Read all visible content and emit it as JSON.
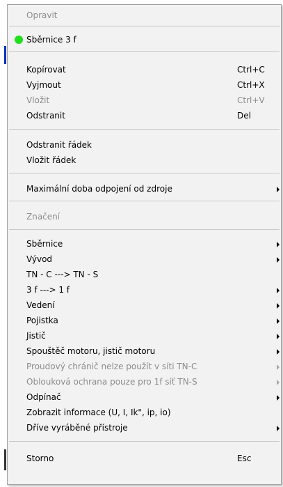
{
  "menu": {
    "items": [
      {
        "label": "Opravit",
        "disabled": true
      },
      {
        "label": "Sběrnice 3 f",
        "indicator": "#1fe01f"
      },
      {
        "label": "Kopírovat",
        "shortcut": "Ctrl+C"
      },
      {
        "label": "Vyjmout",
        "shortcut": "Ctrl+X"
      },
      {
        "label": "Vložit",
        "shortcut": "Ctrl+V",
        "disabled": true
      },
      {
        "label": "Odstranit",
        "shortcut": "Del"
      },
      {
        "label": "Odstranit řádek"
      },
      {
        "label": "Vložit řádek"
      },
      {
        "label": "Maximální doba odpojení od zdroje",
        "submenu": true
      },
      {
        "label": "Značení",
        "disabled": true
      },
      {
        "label": "Sběrnice",
        "submenu": true
      },
      {
        "label": "Vývod",
        "submenu": true
      },
      {
        "label": "TN - C ---> TN - S"
      },
      {
        "label": "3 f ---> 1 f",
        "submenu": true
      },
      {
        "label": "Vedení",
        "submenu": true
      },
      {
        "label": "Pojistka",
        "submenu": true
      },
      {
        "label": "Jistič",
        "submenu": true
      },
      {
        "label": "Spouštěč motoru, jistič motoru",
        "submenu": true
      },
      {
        "label": "Proudový chránič nelze použít v síti TN-C",
        "submenu": true,
        "disabled": true
      },
      {
        "label": "Oblouková ochrana pouze pro 1f síť TN-S",
        "submenu": true,
        "disabled": true
      },
      {
        "label": "Odpínač",
        "submenu": true
      },
      {
        "label": "Zobrazit informace (U, I, Ik\", ip, io)"
      },
      {
        "label": "Dříve vyráběné přístroje",
        "submenu": true
      },
      {
        "label": "Storno",
        "shortcut": "Esc"
      }
    ]
  }
}
